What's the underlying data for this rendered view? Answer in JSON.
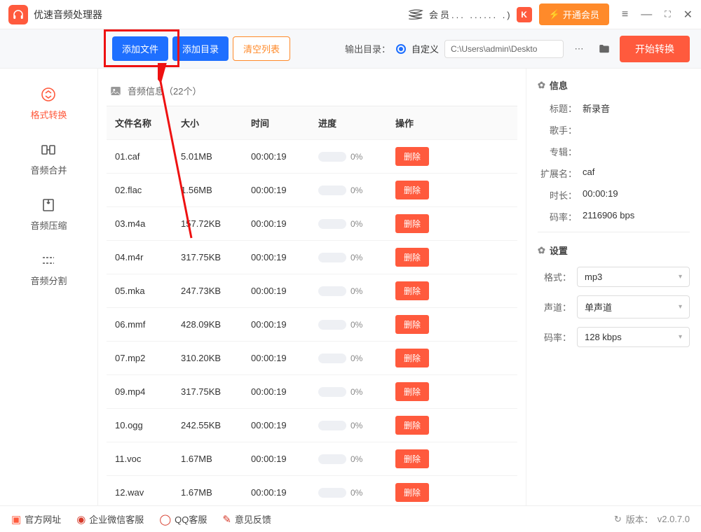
{
  "app": {
    "title": "优速音频处理器"
  },
  "titlebar": {
    "member_text": "会员...  ......  .)",
    "vip_button": "开通会员"
  },
  "toolbar": {
    "add_file": "添加文件",
    "add_dir": "添加目录",
    "clear_list": "清空列表",
    "outdir_label": "输出目录：",
    "outdir_option": "自定义",
    "outdir_path": "C:\\Users\\admin\\Deskto",
    "start": "开始转换"
  },
  "sidebar": {
    "items": [
      {
        "label": "格式转换"
      },
      {
        "label": "音频合并"
      },
      {
        "label": "音频压缩"
      },
      {
        "label": "音频分割"
      }
    ]
  },
  "list": {
    "header": "音频信息（22个）",
    "columns": {
      "name": "文件名称",
      "size": "大小",
      "time": "时间",
      "progress": "进度",
      "op": "操作"
    },
    "delete_label": "删除",
    "progress_text": "0%",
    "rows": [
      {
        "name": "01.caf",
        "size": "5.01MB",
        "time": "00:00:19"
      },
      {
        "name": "02.flac",
        "size": "1.56MB",
        "time": "00:00:19"
      },
      {
        "name": "03.m4a",
        "size": "157.72KB",
        "time": "00:00:19"
      },
      {
        "name": "04.m4r",
        "size": "317.75KB",
        "time": "00:00:19"
      },
      {
        "name": "05.mka",
        "size": "247.73KB",
        "time": "00:00:19"
      },
      {
        "name": "06.mmf",
        "size": "428.09KB",
        "time": "00:00:19"
      },
      {
        "name": "07.mp2",
        "size": "310.20KB",
        "time": "00:00:19"
      },
      {
        "name": "09.mp4",
        "size": "317.75KB",
        "time": "00:00:19"
      },
      {
        "name": "10.ogg",
        "size": "242.55KB",
        "time": "00:00:19"
      },
      {
        "name": "11.voc",
        "size": "1.67MB",
        "time": "00:00:19"
      },
      {
        "name": "12.wav",
        "size": "1.67MB",
        "time": "00:00:19"
      }
    ]
  },
  "info": {
    "section_title": "信息",
    "fields": {
      "title_k": "标题：",
      "title_v": "新录音",
      "artist_k": "歌手：",
      "artist_v": "",
      "album_k": "专辑：",
      "album_v": "",
      "ext_k": "扩展名：",
      "ext_v": "caf",
      "dur_k": "时长：",
      "dur_v": "00:00:19",
      "rate_k": "码率：",
      "rate_v": "2116906 bps"
    }
  },
  "settings": {
    "section_title": "设置",
    "format_k": "格式：",
    "format_v": "mp3",
    "chan_k": "声道：",
    "chan_v": "单声道",
    "bit_k": "码率：",
    "bit_v": "128 kbps"
  },
  "footer": {
    "official": "官方网址",
    "wecom": "企业微信客服",
    "qq": "QQ客服",
    "feedback": "意见反馈",
    "version_label": "版本：",
    "version": "v2.0.7.0"
  }
}
